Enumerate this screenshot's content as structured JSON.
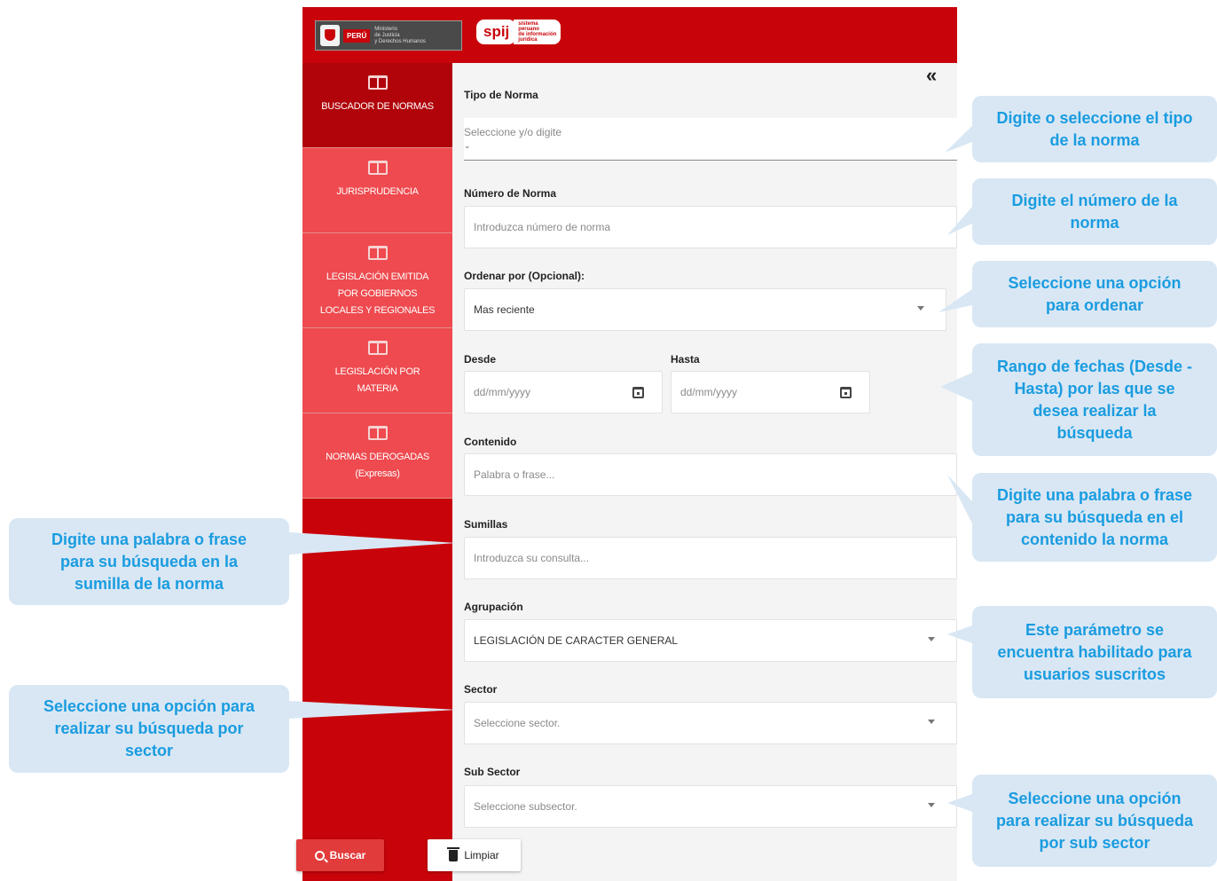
{
  "header": {
    "ministry_badge": "PERÚ",
    "ministry_name": "Ministerio\nde Justicia\ny Derechos Humanos",
    "spij_logo": "spij",
    "spij_tagline": "sistema\nperuano\nde información\njurídica"
  },
  "sidebar": {
    "items": [
      {
        "label": "BUSCADOR DE NORMAS",
        "icon": "book-icon",
        "active": true
      },
      {
        "label": "JURISPRUDENCIA",
        "icon": "book-icon",
        "active": false
      },
      {
        "label": "LEGISLACIÓN EMITIDA\nPOR GOBIERNOS\nLOCALES Y REGIONALES",
        "icon": "book-icon",
        "active": false
      },
      {
        "label": "LEGISLACIÓN POR\nMATERIA",
        "icon": "book-icon",
        "active": false
      },
      {
        "label": "NORMAS DEROGADAS\n(Expresas)",
        "icon": "book-icon",
        "active": false
      }
    ]
  },
  "collapse_glyph": "«",
  "form": {
    "tipo": {
      "label": "Tipo de Norma",
      "placeholder": "Seleccione y/o digite"
    },
    "numero": {
      "label": "Número de Norma",
      "placeholder": "Introduzca número de norma"
    },
    "ordenar": {
      "label": "Ordenar por (Opcional):",
      "value": "Mas reciente"
    },
    "desde": {
      "label": "Desde",
      "placeholder": "dd/mm/yyyy"
    },
    "hasta": {
      "label": "Hasta",
      "placeholder": "dd/mm/yyyy"
    },
    "contenido": {
      "label": "Contenido",
      "placeholder": "Palabra o frase..."
    },
    "sumillas": {
      "label": "Sumillas",
      "placeholder": "Introduzca su consulta..."
    },
    "agrupacion": {
      "label": "Agrupación",
      "value": "LEGISLACIÓN DE CARACTER GENERAL"
    },
    "sector": {
      "label": "Sector",
      "placeholder": "Seleccione sector."
    },
    "subsector": {
      "label": "Sub Sector",
      "placeholder": "Seleccione subsector."
    },
    "buscar_label": "Buscar",
    "limpiar_label": "Limpiar"
  },
  "callouts": {
    "tipo": "Digite o seleccione el tipo\nde la norma",
    "numero": "Digite el número de la\nnorma",
    "ordenar": "Seleccione una opción\npara ordenar",
    "fechas": "Rango de fechas (Desde -\nHasta) por las que se\ndesea realizar la\nbúsqueda",
    "contenido": "Digite una palabra o frase\npara su búsqueda en el\ncontenido la norma",
    "agrupacion": "Este parámetro se\nencuentra habilitado para\nusuarios suscritos",
    "subsector": "Seleccione una opción\npara realizar su búsqueda\npor sub sector",
    "sumillas": "Digite una palabra o frase\npara su búsqueda en la\nsumilla de la norma",
    "sector": "Seleccione una opción para\nrealizar su búsqueda por\nsector"
  },
  "colors": {
    "brand_red": "#c8040a",
    "sidebar_item": "#ee4a4f",
    "callout_bg": "#d9e7f4",
    "callout_text": "#1a9ce0"
  }
}
